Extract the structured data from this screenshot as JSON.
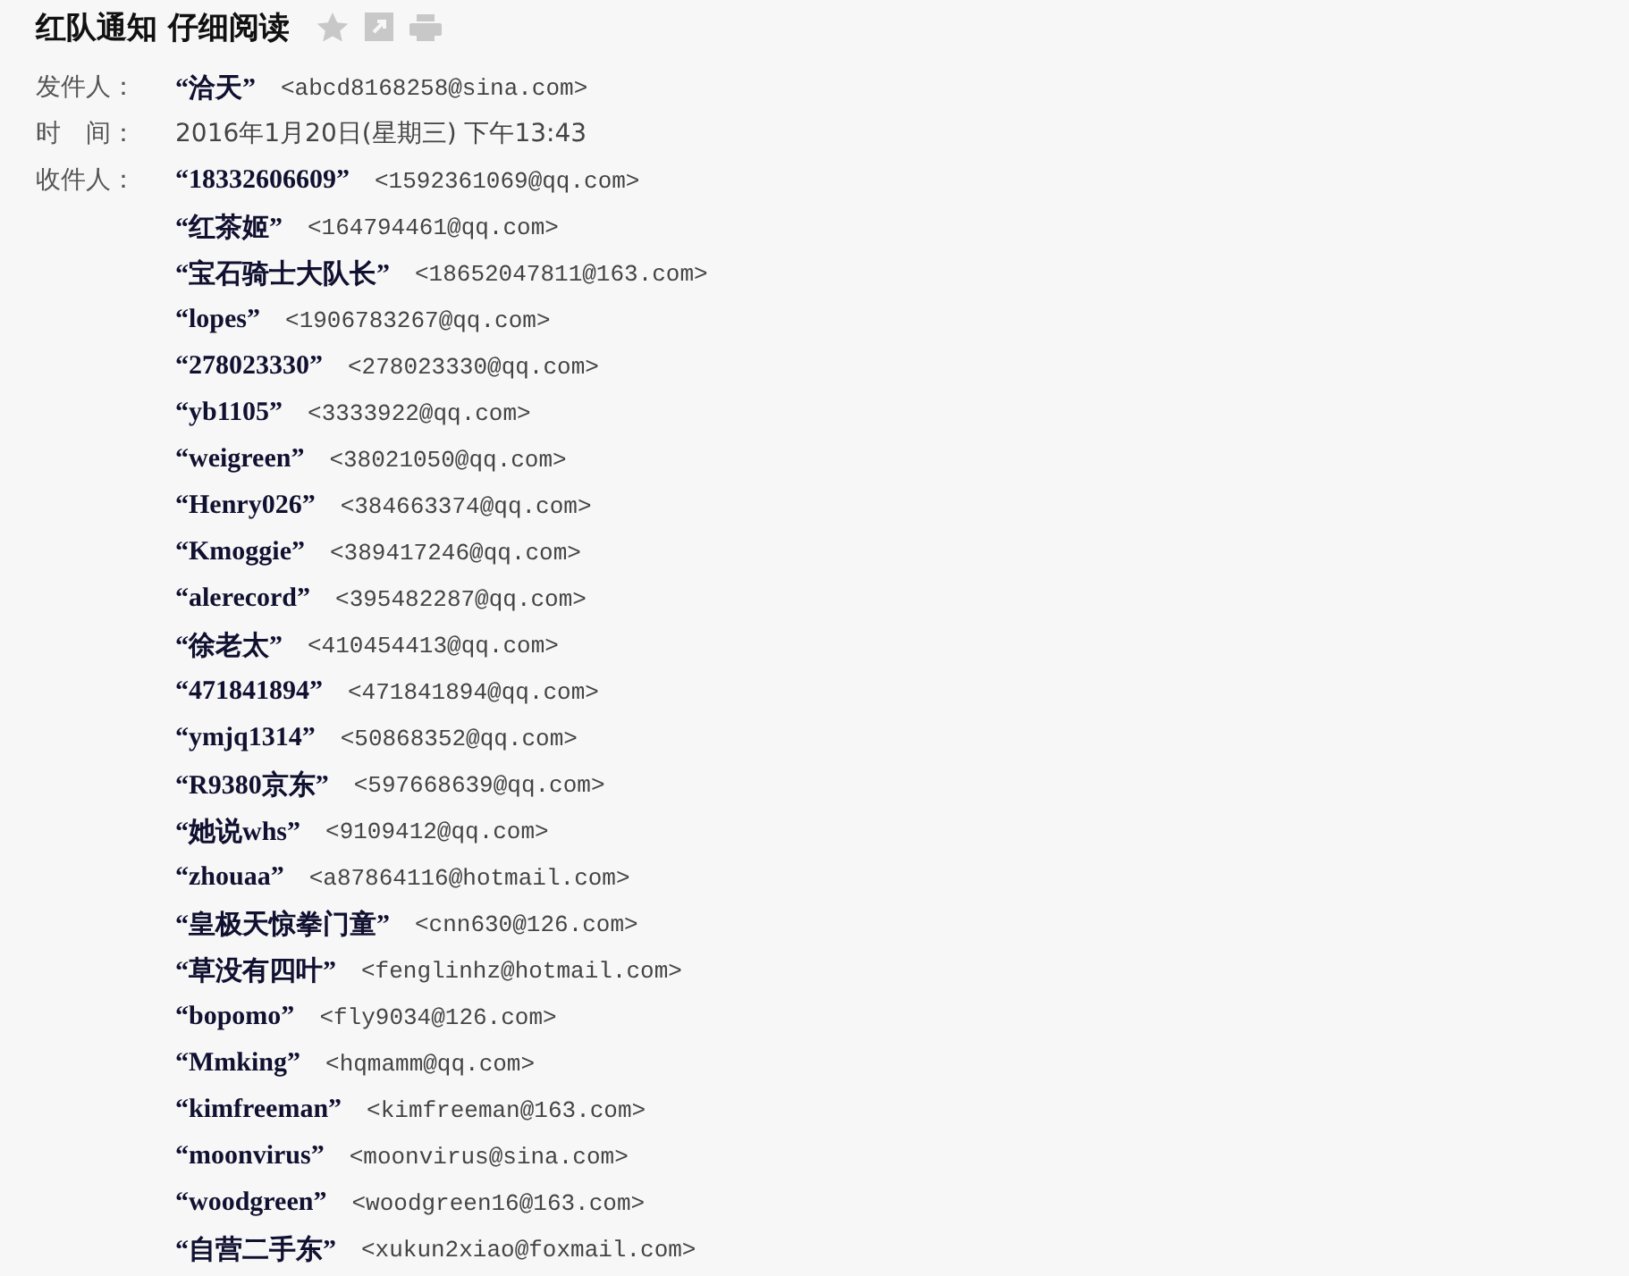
{
  "title": "红队通知 仔细阅读",
  "sender": {
    "label": "发件人：",
    "name": "“洽天”",
    "email": "<abcd8168258@sina.com>"
  },
  "time": {
    "label": "时　间：",
    "value": "2016年1月20日(星期三) 下午13:43"
  },
  "recipients_label": "收件人：",
  "recipients": [
    {
      "name": "“18332606609”",
      "email": "<1592361069@qq.com>"
    },
    {
      "name": "“红茶姬”",
      "email": "<164794461@qq.com>"
    },
    {
      "name": "“宝石骑士大队长”",
      "email": "<18652047811@163.com>"
    },
    {
      "name": "“lopes”",
      "email": "<1906783267@qq.com>"
    },
    {
      "name": "“278023330”",
      "email": "<278023330@qq.com>"
    },
    {
      "name": "“yb1105”",
      "email": "<3333922@qq.com>"
    },
    {
      "name": "“weigreen”",
      "email": "<38021050@qq.com>"
    },
    {
      "name": "“Henry026”",
      "email": "<384663374@qq.com>"
    },
    {
      "name": "“Kmoggie”",
      "email": "<389417246@qq.com>"
    },
    {
      "name": "“alerecord”",
      "email": "<395482287@qq.com>"
    },
    {
      "name": "“徐老太”",
      "email": "<410454413@qq.com>"
    },
    {
      "name": "“471841894”",
      "email": "<471841894@qq.com>"
    },
    {
      "name": "“ymjq1314”",
      "email": "<50868352@qq.com>"
    },
    {
      "name": "“R9380京东”",
      "email": "<597668639@qq.com>"
    },
    {
      "name": "“她说whs”",
      "email": "<9109412@qq.com>"
    },
    {
      "name": "“zhouaa”",
      "email": "<a87864116@hotmail.com>"
    },
    {
      "name": "“皇极天惊拳门童”",
      "email": "<cnn630@126.com>"
    },
    {
      "name": "“草没有四叶”",
      "email": "<fenglinhz@hotmail.com>"
    },
    {
      "name": "“bopomo”",
      "email": "<fly9034@126.com>"
    },
    {
      "name": "“Mmking”",
      "email": "<hqmamm@qq.com>"
    },
    {
      "name": "“kimfreeman”",
      "email": "<kimfreeman@163.com>"
    },
    {
      "name": "“moonvirus”",
      "email": "<moonvirus@sina.com>"
    },
    {
      "name": "“woodgreen”",
      "email": "<woodgreen16@163.com>"
    },
    {
      "name": "“自营二手东”",
      "email": "<xukun2xiao@foxmail.com>"
    }
  ]
}
